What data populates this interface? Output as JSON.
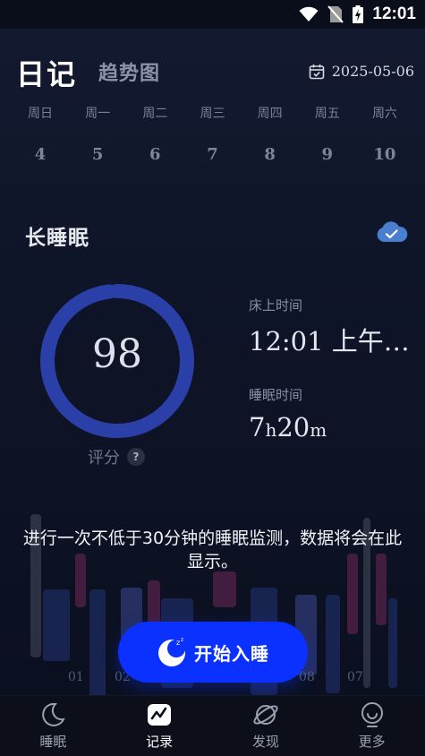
{
  "status_bar": {
    "time": "12:01"
  },
  "header": {
    "title": "日记",
    "tab_trend": "趋势图",
    "date": "2025-05-06"
  },
  "week": {
    "weekday_labels": [
      "周日",
      "周一",
      "周二",
      "周三",
      "周四",
      "周五",
      "周六"
    ],
    "days": [
      "4",
      "5",
      "6",
      "7",
      "8",
      "9",
      "10"
    ]
  },
  "sleep_section": {
    "title": "长睡眠",
    "score": "98",
    "score_label": "评分",
    "score_help": "?",
    "inbed_label": "床上时间",
    "inbed_value": "12:01 上午…",
    "sleep_label": "睡眠时间",
    "sleep_hours": "7",
    "sleep_hours_unit": "h",
    "sleep_minutes": "20",
    "sleep_minutes_unit": "m"
  },
  "chart_placeholder": {
    "x_labels": [
      "01",
      "02",
      "08",
      "07"
    ]
  },
  "empty_message": "进行一次不低于30分钟的睡眠监测，数据将会在此显示。",
  "start_button": {
    "label": "开始入睡"
  },
  "nav": {
    "items": [
      {
        "label": "睡眠",
        "icon": "moon-icon"
      },
      {
        "label": "记录",
        "icon": "record-chart-icon"
      },
      {
        "label": "发现",
        "icon": "planet-icon"
      },
      {
        "label": "更多",
        "icon": "bulb-icon"
      }
    ],
    "active_index": 1
  },
  "colors": {
    "accent": "#0a31ff",
    "ring": "#2a3fa8",
    "cloud": "#4a7fd0",
    "background": "#0b1020"
  }
}
